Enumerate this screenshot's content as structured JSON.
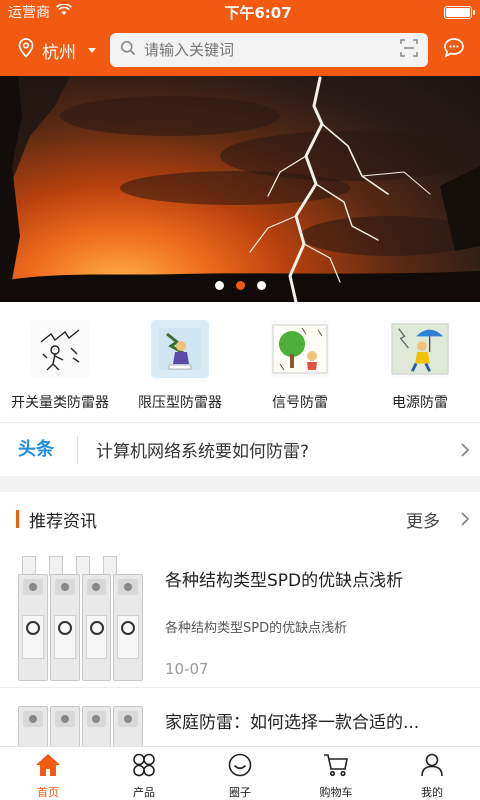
{
  "status_bar": {
    "carrier": "运营商",
    "time": "下午6:07"
  },
  "header": {
    "city": "杭州",
    "search_placeholder": "请输入关键词"
  },
  "banner": {
    "page_count": 3,
    "active_index": 1
  },
  "categories": [
    {
      "label": "开关量类防雷器",
      "icon": "switch-spd-icon"
    },
    {
      "label": "限压型防雷器",
      "icon": "voltage-limit-spd-icon"
    },
    {
      "label": "信号防雷",
      "icon": "signal-protection-icon"
    },
    {
      "label": "电源防雷",
      "icon": "power-protection-icon"
    }
  ],
  "headline": {
    "tag": "头条",
    "text": "计算机网络系统要如何防雷?"
  },
  "recommended": {
    "title": "推荐资讯",
    "more": "更多",
    "articles": [
      {
        "title": "各种结构类型SPD的优缺点浅析",
        "summary": "各种结构类型SPD的优缺点浅析",
        "date": "10-07"
      },
      {
        "title": "家庭防雷：如何选择一款合适的..."
      }
    ]
  },
  "tabbar": [
    {
      "label": "首页",
      "icon": "home-icon",
      "active": true
    },
    {
      "label": "产品",
      "icon": "grid-icon",
      "active": false
    },
    {
      "label": "圈子",
      "icon": "smile-icon",
      "active": false
    },
    {
      "label": "购物车",
      "icon": "cart-icon",
      "active": false
    },
    {
      "label": "我的",
      "icon": "user-icon",
      "active": false
    }
  ],
  "colors": {
    "accent": "#f25a12",
    "headline_tag": "#1e8fdc"
  }
}
